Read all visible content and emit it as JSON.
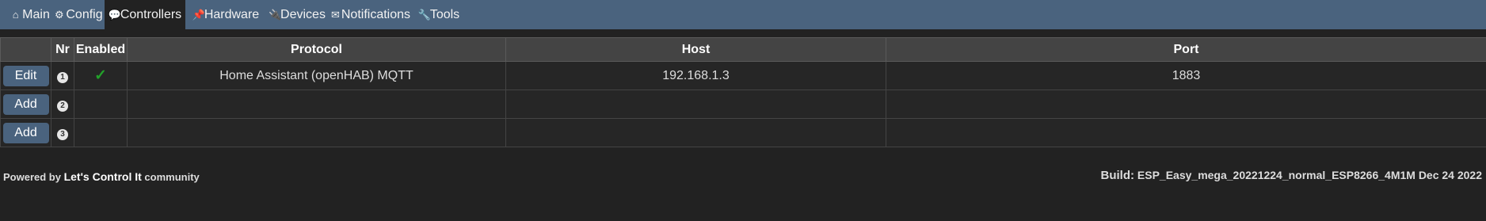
{
  "nav": {
    "items": [
      {
        "label": "Main",
        "icon": "home-icon",
        "glyph": "⌂"
      },
      {
        "label": "Config",
        "icon": "gear-icon",
        "glyph": "⚙"
      },
      {
        "label": "Controllers",
        "icon": "speech-bubble-icon",
        "glyph": "💬"
      },
      {
        "label": "Hardware",
        "icon": "pushpin-icon",
        "glyph": "📌"
      },
      {
        "label": "Devices",
        "icon": "plug-icon",
        "glyph": "🔌"
      },
      {
        "label": "Notifications",
        "icon": "envelope-icon",
        "glyph": "✉"
      },
      {
        "label": "Tools",
        "icon": "wrench-icon",
        "glyph": "🔧"
      }
    ],
    "active": "Controllers"
  },
  "table": {
    "headers": [
      "",
      "Nr",
      "Enabled",
      "Protocol",
      "Host",
      "Port"
    ],
    "rows": [
      {
        "button": "Edit",
        "nr": "1",
        "enabled": "✓",
        "protocol": "Home Assistant (openHAB) MQTT",
        "host": "192.168.1.3",
        "port": "1883"
      },
      {
        "button": "Add",
        "nr": "2",
        "enabled": "",
        "protocol": "",
        "host": "",
        "port": ""
      },
      {
        "button": "Add",
        "nr": "3",
        "enabled": "",
        "protocol": "",
        "host": "",
        "port": ""
      }
    ]
  },
  "footer": {
    "powered_prefix": "Powered by ",
    "powered_name": "Let's Control It",
    "powered_suffix": " community",
    "build_label": "Build:",
    "build_value": " ESP_Easy_mega_20221224_normal_ESP8266_4M1M Dec 24 2022"
  },
  "colors": {
    "navbar": "#4a637e",
    "background": "#222222",
    "header": "#444444",
    "button": "#4a637e",
    "check": "#22a12a"
  }
}
